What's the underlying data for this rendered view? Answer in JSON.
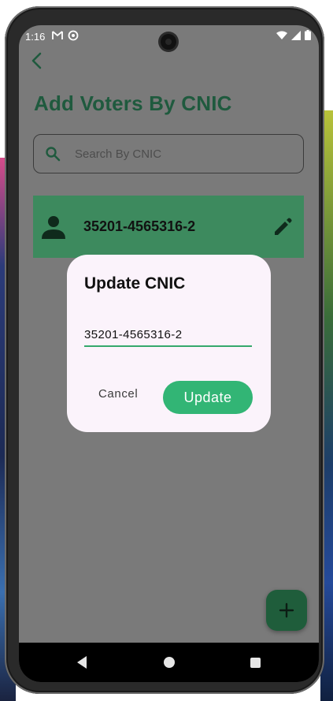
{
  "status_bar": {
    "time": "1:16",
    "left_icons": [
      "gmail-icon",
      "sync-icon"
    ],
    "right_icons": [
      "wifi-icon",
      "signal-icon",
      "battery-icon"
    ]
  },
  "header": {
    "back_icon": "chevron-left-icon",
    "title": "Add Voters By CNIC"
  },
  "search": {
    "icon": "search-icon",
    "placeholder": "Search By CNIC",
    "value": ""
  },
  "voters": [
    {
      "cnic": "35201-4565316-2",
      "icon": "person-icon",
      "action_icon": "edit-icon"
    }
  ],
  "fab": {
    "icon": "plus-icon"
  },
  "dialog": {
    "title": "Update CNIC",
    "input_value": "35201-4565316-2",
    "cancel_label": "Cancel",
    "update_label": "Update"
  },
  "colors": {
    "accent": "#32b575",
    "title_green": "#1f5a3e",
    "card_green": "#3d8a5e",
    "scrim": "#7a7a7a",
    "dialog_bg": "#fbf3fb"
  },
  "nav_bar": [
    "nav-back-icon",
    "nav-home-icon",
    "nav-recents-icon"
  ]
}
